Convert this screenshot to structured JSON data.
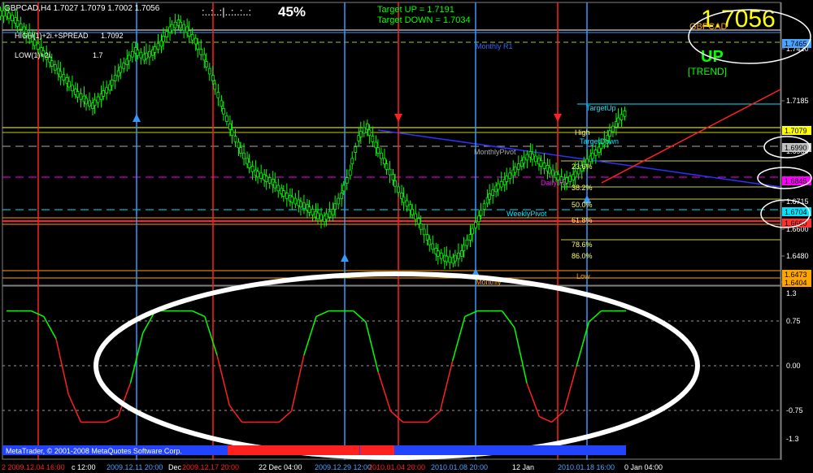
{
  "header": {
    "symbol_line": "GBPCAD,H4  1.7027 1.7079 1.7002 1.7056",
    "progress_dots": ":..:..:|..:..:..:",
    "progress_pct": "45%",
    "target_up": "Target UP      = 1.7191",
    "target_down": "Target DOWN = 1.7034",
    "big_price": "1.7056",
    "pair": "GBPCAD",
    "trend_word": "UP",
    "trend_tag": "[TREND]",
    "ind_label": "HIGH(1)+2i.+SPREAD",
    "ind_value": "1.7092",
    "low_label": "LOW(1)+2i.",
    "low_value": "1.7",
    "copyright": "MetaTrader, © 2001-2008 MetaQuotes Software Corp."
  },
  "price_axis": {
    "ticks": [
      "1.7420",
      "1.7185",
      "1.6950",
      "1.6715",
      "1.6600",
      "1.6480",
      "1.6365"
    ],
    "badges": [
      {
        "text": "1.7465",
        "color": "#4aa3ff"
      },
      {
        "text": "1.7079",
        "color": "#ffff00"
      },
      {
        "text": "1.6990",
        "color": "#c0c0c0"
      },
      {
        "text": "1.6845",
        "color": "#ff00ff"
      },
      {
        "text": "1.6704",
        "color": "#00e5ff"
      },
      {
        "text": "1.6660",
        "color": "#ff3030"
      },
      {
        "text": "1.6473",
        "color": "#ffa500"
      },
      {
        "text": "1.6404",
        "color": "#ffa500"
      }
    ]
  },
  "osc_axis": {
    "ticks": [
      "1.3",
      "0.75",
      "0.00",
      "-0.75",
      "-1.3"
    ]
  },
  "levels": {
    "monthly_r1": "Monthly R1",
    "target_up": "TargetUp",
    "target_down": "TargetDown",
    "high": "High",
    "monthly_pivot": "MonthlyPivot",
    "daily_pivot": "Daily Pi",
    "weekly_pivot": "WeeklyPivot",
    "monthly_s": "Monthly",
    "low": "Low",
    "fib": [
      "23.6%",
      "38.2%",
      "50.0%",
      "61.8%",
      "78.6%",
      "86.0%"
    ]
  },
  "time_axis": {
    "labels": [
      {
        "text": "2 2009.12.04 16:00",
        "color": "#ff2020"
      },
      {
        "text": "c 12:00",
        "color": "#ffffff"
      },
      {
        "text": "2009.12.11 20:00",
        "color": "#4aa3ff"
      },
      {
        "text": "Dec",
        "color": "#ffffff"
      },
      {
        "text": "2009.12.17 20:00",
        "color": "#ff2020"
      },
      {
        "text": "22 Dec 04:00",
        "color": "#ffffff"
      },
      {
        "text": "2009.12.29 12:00",
        "color": "#4aa3ff"
      },
      {
        "text": "2010.01.04 20:00",
        "color": "#ff2020"
      },
      {
        "text": "2010.01.08 20:00",
        "color": "#4aa3ff"
      },
      {
        "text": "12 Jan",
        "color": "#ffffff"
      },
      {
        "text": "2010.01.18 16:00",
        "color": "#4aa3ff"
      },
      {
        "text": "0 Jan 04:00",
        "color": "#ffffff"
      }
    ]
  },
  "colors": {
    "candles": "#00ff00",
    "buy_line": "#3399ff",
    "sell_line": "#ff2020",
    "osc_up": "#00ff00",
    "osc_down": "#ff2020",
    "ellipse": "#ffffff"
  },
  "chart_data": [
    {
      "type": "line",
      "title": "GBPCAD,H4",
      "price_series": {
        "name": "",
        "values": [
          1.749,
          1.746,
          1.742,
          1.738,
          1.733,
          1.729,
          1.724,
          1.72,
          1.715,
          1.712,
          1.709,
          1.713,
          1.717,
          1.723,
          1.728,
          1.733,
          1.73,
          1.732,
          1.736,
          1.742,
          1.745,
          1.742,
          1.737,
          1.73,
          1.721,
          1.71,
          1.7,
          1.692,
          1.685,
          1.68,
          1.678,
          1.676,
          1.672,
          1.669,
          1.667,
          1.665,
          1.662,
          1.66,
          1.663,
          1.67,
          1.68,
          1.695,
          1.7,
          1.692,
          1.685,
          1.678,
          1.67,
          1.665,
          1.659,
          1.652,
          1.646,
          1.643,
          1.642,
          1.645,
          1.652,
          1.66,
          1.668,
          1.673,
          1.676,
          1.68,
          1.684,
          1.688,
          1.685,
          1.682,
          1.679,
          1.676,
          1.678,
          1.682,
          1.686,
          1.69,
          1.695,
          1.701,
          1.7056
        ]
      },
      "ylim": [
        1.633,
        1.752
      ]
    },
    {
      "type": "line",
      "title": "",
      "oscillator_series": {
        "name": "",
        "values": [
          1.0,
          1.0,
          1.0,
          0.9,
          0.5,
          -0.5,
          -1.0,
          -1.0,
          -1.0,
          -0.9,
          -0.3,
          0.6,
          1.0,
          1.0,
          1.0,
          1.0,
          0.9,
          0.2,
          -0.7,
          -1.0,
          -1.0,
          -1.0,
          -1.0,
          -0.8,
          0.2,
          0.9,
          1.0,
          1.0,
          1.0,
          0.8,
          -0.1,
          -0.8,
          -1.0,
          -1.0,
          -1.0,
          -0.8,
          0.1,
          0.9,
          1.0,
          1.0,
          1.0,
          0.7,
          -0.3,
          -0.9,
          -1.0,
          -0.8,
          0.0,
          0.8,
          1.0,
          1.0,
          1.0
        ]
      },
      "ylim": [
        -1.3,
        1.3
      ]
    }
  ]
}
